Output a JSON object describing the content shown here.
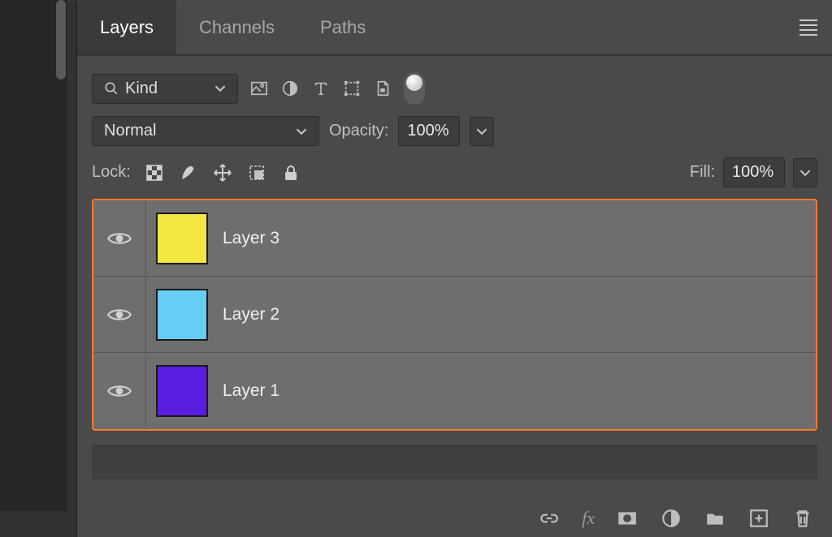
{
  "tabs": {
    "layers": "Layers",
    "channels": "Channels",
    "paths": "Paths"
  },
  "filter": {
    "kind_label": "Kind"
  },
  "blend": {
    "mode": "Normal",
    "opacity_label": "Opacity:",
    "opacity_value": "100%"
  },
  "lock": {
    "label": "Lock:",
    "fill_label": "Fill:",
    "fill_value": "100%"
  },
  "layers": [
    {
      "name": "Layer 3",
      "color": "#f4e640"
    },
    {
      "name": "Layer 2",
      "color": "#67cdf4"
    },
    {
      "name": "Layer 1",
      "color": "#5a1ee0"
    }
  ]
}
